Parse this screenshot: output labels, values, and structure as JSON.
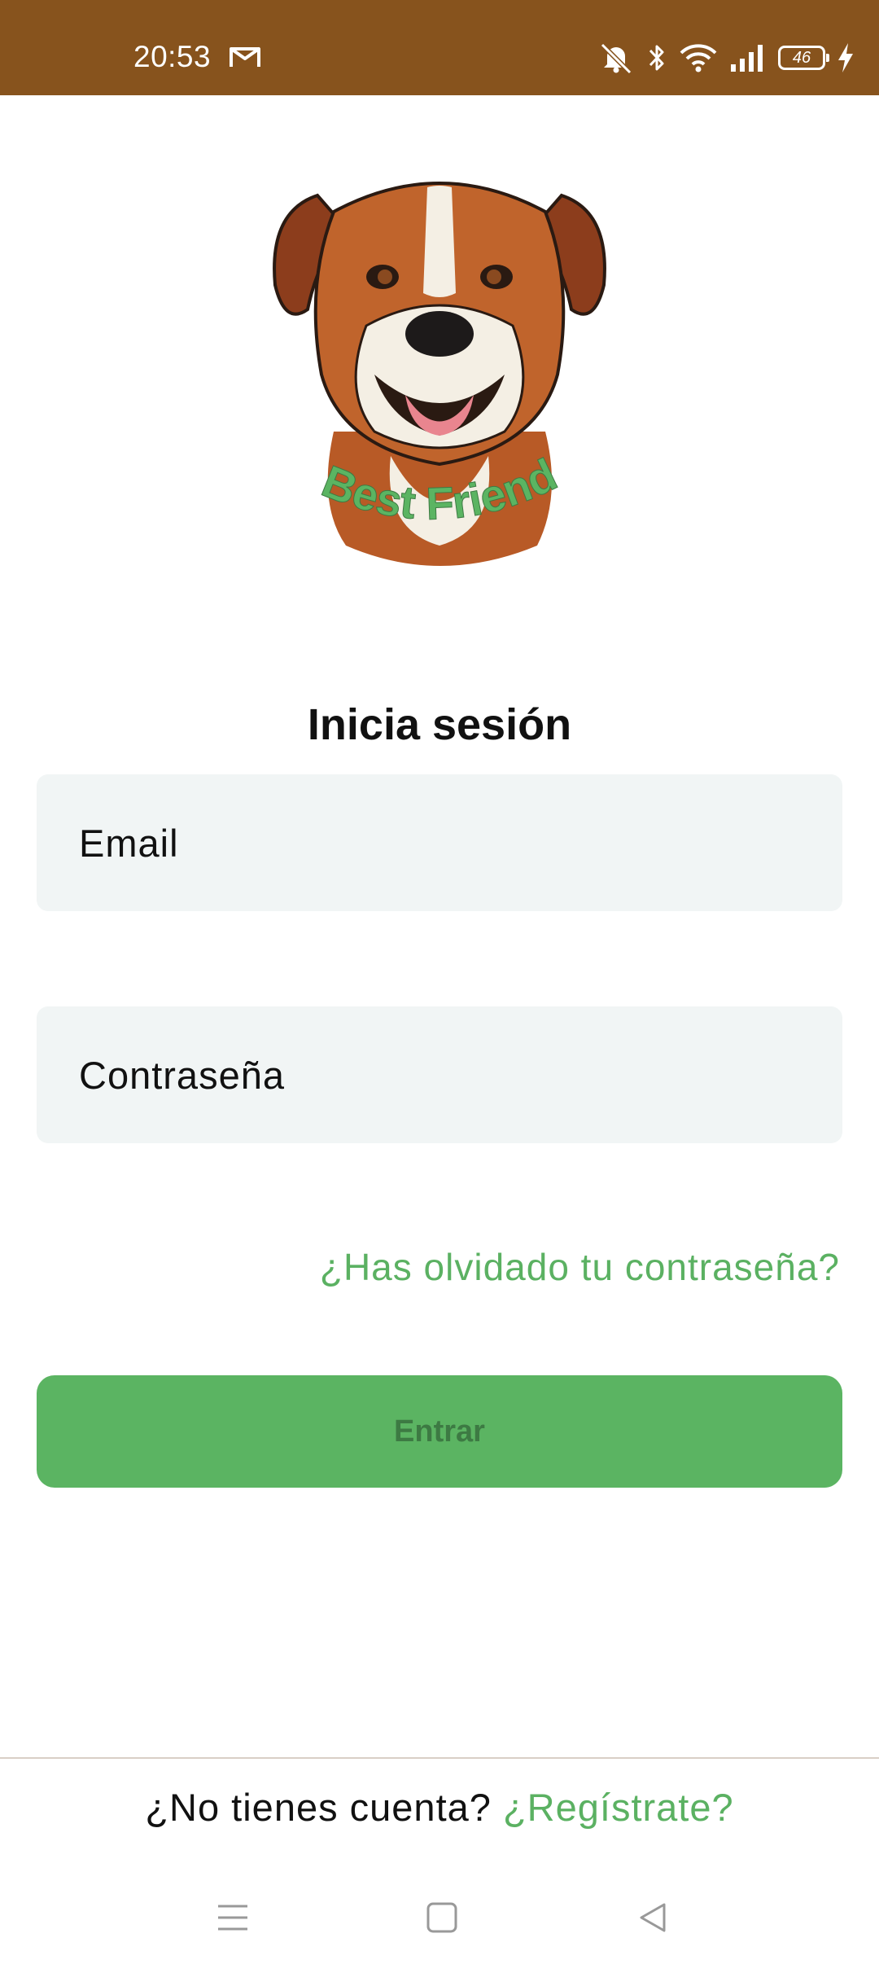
{
  "status_bar": {
    "time": "20:53",
    "icons": [
      "gmail-icon",
      "mute-icon",
      "bluetooth-icon",
      "wifi-icon",
      "signal-icon",
      "battery-icon",
      "charging-icon"
    ],
    "battery_level": "46",
    "background_color": "#87531d"
  },
  "logo": {
    "brand_text": "Best Friend",
    "description_icon": "boxer-dog-logo"
  },
  "login": {
    "title": "Inicia sesión",
    "email_placeholder": "Email",
    "password_placeholder": "Contraseña",
    "forgot_password_link": "¿Has olvidado tu contraseña?",
    "enter_button": "Entrar"
  },
  "footer": {
    "no_account_text": "¿No tienes cuenta?",
    "register_link": "¿Regístrate?"
  },
  "colors": {
    "accent_green": "#5bb462",
    "link_green": "#5bb162",
    "field_bg": "#f1f5f5"
  },
  "nav_bar": {
    "icons": [
      "menu-icon",
      "home-icon",
      "back-icon"
    ]
  }
}
